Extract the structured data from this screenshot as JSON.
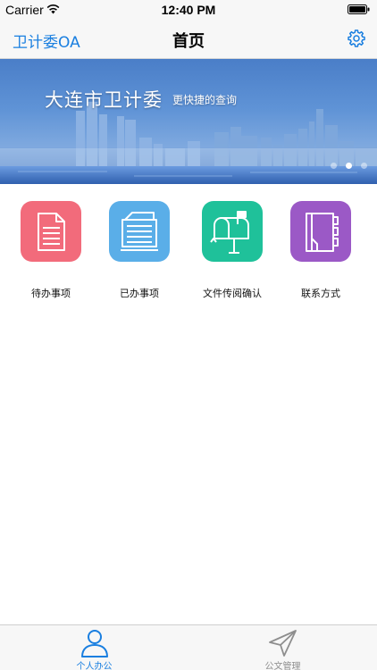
{
  "status_bar": {
    "carrier": "Carrier",
    "time": "12:40 PM"
  },
  "nav": {
    "left_label": "卫计委OA",
    "title": "首页",
    "settings_icon": "gear-icon"
  },
  "banner": {
    "title": "大连市卫计委",
    "subtitle": "更快捷的查询",
    "page_count": 3,
    "active_page": 2
  },
  "grid": [
    {
      "label": "待办事项",
      "icon": "document-icon",
      "color": "#f26b7b"
    },
    {
      "label": "已办事项",
      "icon": "stack-icon",
      "color": "#5aaee8"
    },
    {
      "label": "文件传阅确认",
      "icon": "mailbox-icon",
      "color": "#1fc19a"
    },
    {
      "label": "联系方式",
      "icon": "contact-book-icon",
      "color": "#9b59c6"
    }
  ],
  "tabs": [
    {
      "label": "个人办公",
      "icon": "person-icon",
      "active": true
    },
    {
      "label": "公文管理",
      "icon": "paper-plane-icon",
      "active": false
    }
  ],
  "colors": {
    "accent": "#1a7fe0",
    "inactive": "#8e8e8e"
  }
}
